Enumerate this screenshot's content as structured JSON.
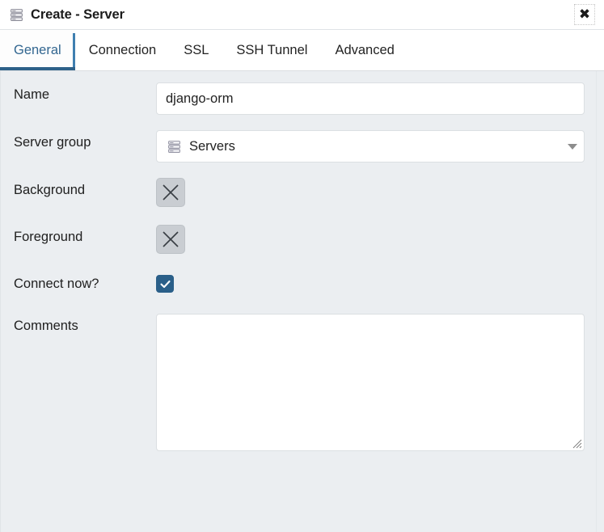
{
  "window": {
    "title": "Create - Server",
    "title_icon": "server-stack-icon",
    "close_label": "✖"
  },
  "tabs": [
    {
      "id": "general",
      "label": "General",
      "active": true
    },
    {
      "id": "connection",
      "label": "Connection",
      "active": false
    },
    {
      "id": "ssl",
      "label": "SSL",
      "active": false
    },
    {
      "id": "ssh-tunnel",
      "label": "SSH Tunnel",
      "active": false
    },
    {
      "id": "advanced",
      "label": "Advanced",
      "active": false
    }
  ],
  "form": {
    "name": {
      "label": "Name",
      "value": "django-orm",
      "placeholder": ""
    },
    "server_group": {
      "label": "Server group",
      "value": "Servers",
      "icon": "server-stack-icon",
      "caret": "chevron-down-icon"
    },
    "background": {
      "label": "Background",
      "value": "",
      "swatch_state": "no-color"
    },
    "foreground": {
      "label": "Foreground",
      "value": "",
      "swatch_state": "no-color"
    },
    "connect_now": {
      "label": "Connect now?",
      "checked": true
    },
    "comments": {
      "label": "Comments",
      "value": "",
      "placeholder": ""
    }
  },
  "colors": {
    "accent": "#2a5f89",
    "tab_active_text": "#326690",
    "tab_underline": "#2e6189",
    "body_bg": "#ebeef1",
    "panel_bg": "#ffffff",
    "border": "#dbdfe2",
    "swatch_bg": "#c9cdd2",
    "text": "#202020"
  }
}
